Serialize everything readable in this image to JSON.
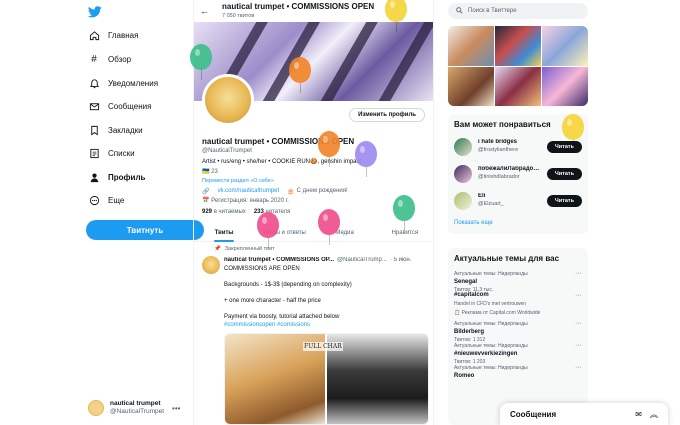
{
  "nav": {
    "items": [
      {
        "label": "Главная",
        "icon": "home-icon"
      },
      {
        "label": "Обзор",
        "icon": "hashtag-icon"
      },
      {
        "label": "Уведомления",
        "icon": "bell-icon"
      },
      {
        "label": "Сообщения",
        "icon": "mail-icon"
      },
      {
        "label": "Закладки",
        "icon": "bookmark-icon"
      },
      {
        "label": "Списки",
        "icon": "list-icon"
      },
      {
        "label": "Профиль",
        "icon": "person-icon"
      },
      {
        "label": "Еще",
        "icon": "more-icon"
      }
    ],
    "tweet_button": "Твитнуть",
    "account": {
      "name": "nautical trumpet",
      "handle": "@NauticalTrumpet"
    }
  },
  "profile": {
    "header_title": "nautical trumpet • COMMISSIONS OPEN",
    "header_count": "7 050 твитов",
    "edit_button": "Изменить профиль",
    "name": "nautical trumpet • COMMISSIONS OPEN",
    "handle": "@NauticalTrumpet",
    "bio": "Artist • rus/eng • she/her • COOKIE RUN🍪, genshin impact",
    "flag_line": "🇺🇦 23",
    "translate": "Перевести раздел «О себе»",
    "link": "vk.com/nauticaltrumpet",
    "birthday": "С днем рождения!",
    "joined": "Регистрация: январь 2020 г.",
    "following_count": "929",
    "following_label": "в читаемых",
    "followers_count": "233",
    "followers_label": "читателя",
    "tabs": [
      "Твиты",
      "Твиты и ответы",
      "Медиа",
      "Нравится"
    ]
  },
  "tweet": {
    "pinned_label": "Закрепленный твит",
    "author": "nautical trumpet • COMMISSIONS OP...",
    "handle": "@NauticalTrump...",
    "time": "· 5 июн.",
    "lines": [
      "COMMISSIONS ARE OPEN",
      "Backgrounds - 1$-3$ (depending on complexity)",
      "+ one more character - half the price",
      "Payment via boosty, tutorial attached below",
      "#commissionsopen #comissions"
    ],
    "media_caption": "FULL CHAR"
  },
  "right": {
    "search_placeholder": "Поиск в Твиттере",
    "who_title": "Вам может понравиться",
    "who": [
      {
        "name": "i hate bridges",
        "handle": "@frostylianthere",
        "button": "Читать"
      },
      {
        "name": "побежалиЛабрадо…",
        "handle": "@tinishdlabrador",
        "button": "Читать"
      },
      {
        "name": "Eli",
        "handle": "@Elzuart_",
        "button": "Читать"
      }
    ],
    "show_more": "Показать еще",
    "trends_title": "Актуальные темы для вас",
    "trends": [
      {
        "ctx": "Актуальные темы: Нидерланды",
        "name": "Senegal",
        "count": "Твитов: 11,3 тыс."
      },
      {
        "ctx": "",
        "name": "#capitalcom",
        "count": "Handel in CFD's met vertrouwen"
      },
      {
        "ctx": "",
        "name": "",
        "count": "Реклама от Capital.com Worldwide"
      },
      {
        "ctx": "Актуальные темы: Нидерланды",
        "name": "Bilderberg",
        "count": "Твитов: 1 312"
      },
      {
        "ctx": "Актуальные темы: Нидерланды",
        "name": "#nieuwevverkiezingen",
        "count": "Твитов: 1 203"
      },
      {
        "ctx": "Актуальные темы: Нидерланды",
        "name": "Romeo",
        "count": ""
      }
    ],
    "messages_dock": "Сообщения"
  },
  "colors": {
    "accent": "#1d9bf0",
    "text": "#0f1419",
    "muted": "#536471"
  }
}
